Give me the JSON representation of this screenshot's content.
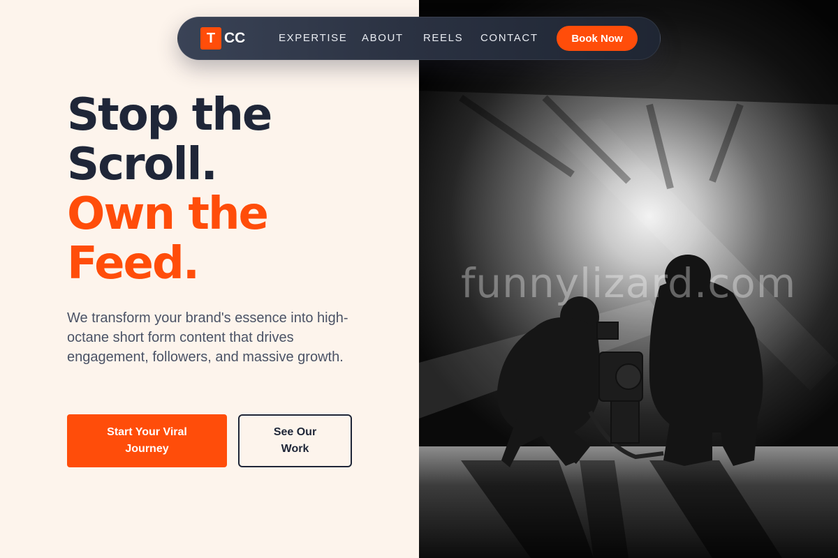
{
  "brand": {
    "logo_letter": "T",
    "logo_text": "CC",
    "accent": "#ff4d0a",
    "dark": "#1f2638"
  },
  "nav": {
    "links": [
      "EXPERTISE",
      "ABOUT",
      "REELS",
      "CONTACT"
    ],
    "cta": "Book Now"
  },
  "hero": {
    "line1": "Stop the",
    "line2": "Scroll.",
    "line3": "Own the",
    "line4": "Feed.",
    "description": "We transform your brand's essence into high-octane short form content that drives engagement, followers, and massive growth.",
    "primary_button": "Start Your Viral Journey",
    "secondary_button": "See Our Work"
  },
  "image": {
    "subject": "black-and-white photo of two crouching camera operators with a gimbal rig",
    "watermark": "funnylizard.com"
  }
}
